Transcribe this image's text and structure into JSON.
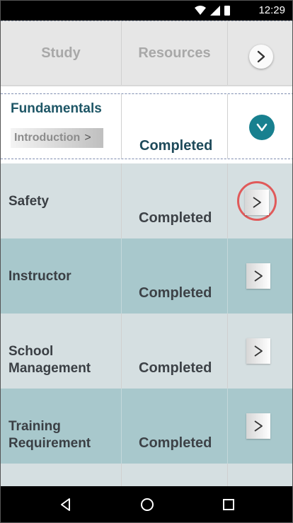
{
  "status_bar": {
    "time": "12:29",
    "icons": [
      "wifi-icon",
      "signal-icon",
      "battery-icon"
    ]
  },
  "header": {
    "col1": "Study",
    "col2": "Resources",
    "next_icon": "chevron-right-icon"
  },
  "expanded_module": {
    "title": "Fundamentals",
    "intro_label": "Introduction",
    "intro_arrow": ">",
    "status": "Completed",
    "toggle_icon": "chevron-down-icon"
  },
  "lessons": [
    {
      "name_lines": [
        "Safety"
      ],
      "status": "Completed",
      "go_label": ">",
      "highlighted": true
    },
    {
      "name_lines": [
        "Instructor"
      ],
      "status": "Completed",
      "go_label": ">"
    },
    {
      "name_lines": [
        "School",
        "Management"
      ],
      "status": "Completed",
      "go_label": ">"
    },
    {
      "name_lines": [
        "Training",
        "Requirement"
      ],
      "status": "Completed",
      "go_label": ">"
    }
  ],
  "nav_bar": {
    "icons": [
      "back-icon",
      "home-icon",
      "recents-icon"
    ]
  },
  "colors": {
    "accent": "#18808f",
    "row_light": "#d5dfe1",
    "row_dark": "#a8c8cc",
    "module_title": "#1e5666",
    "highlight": "#e05a5a"
  }
}
